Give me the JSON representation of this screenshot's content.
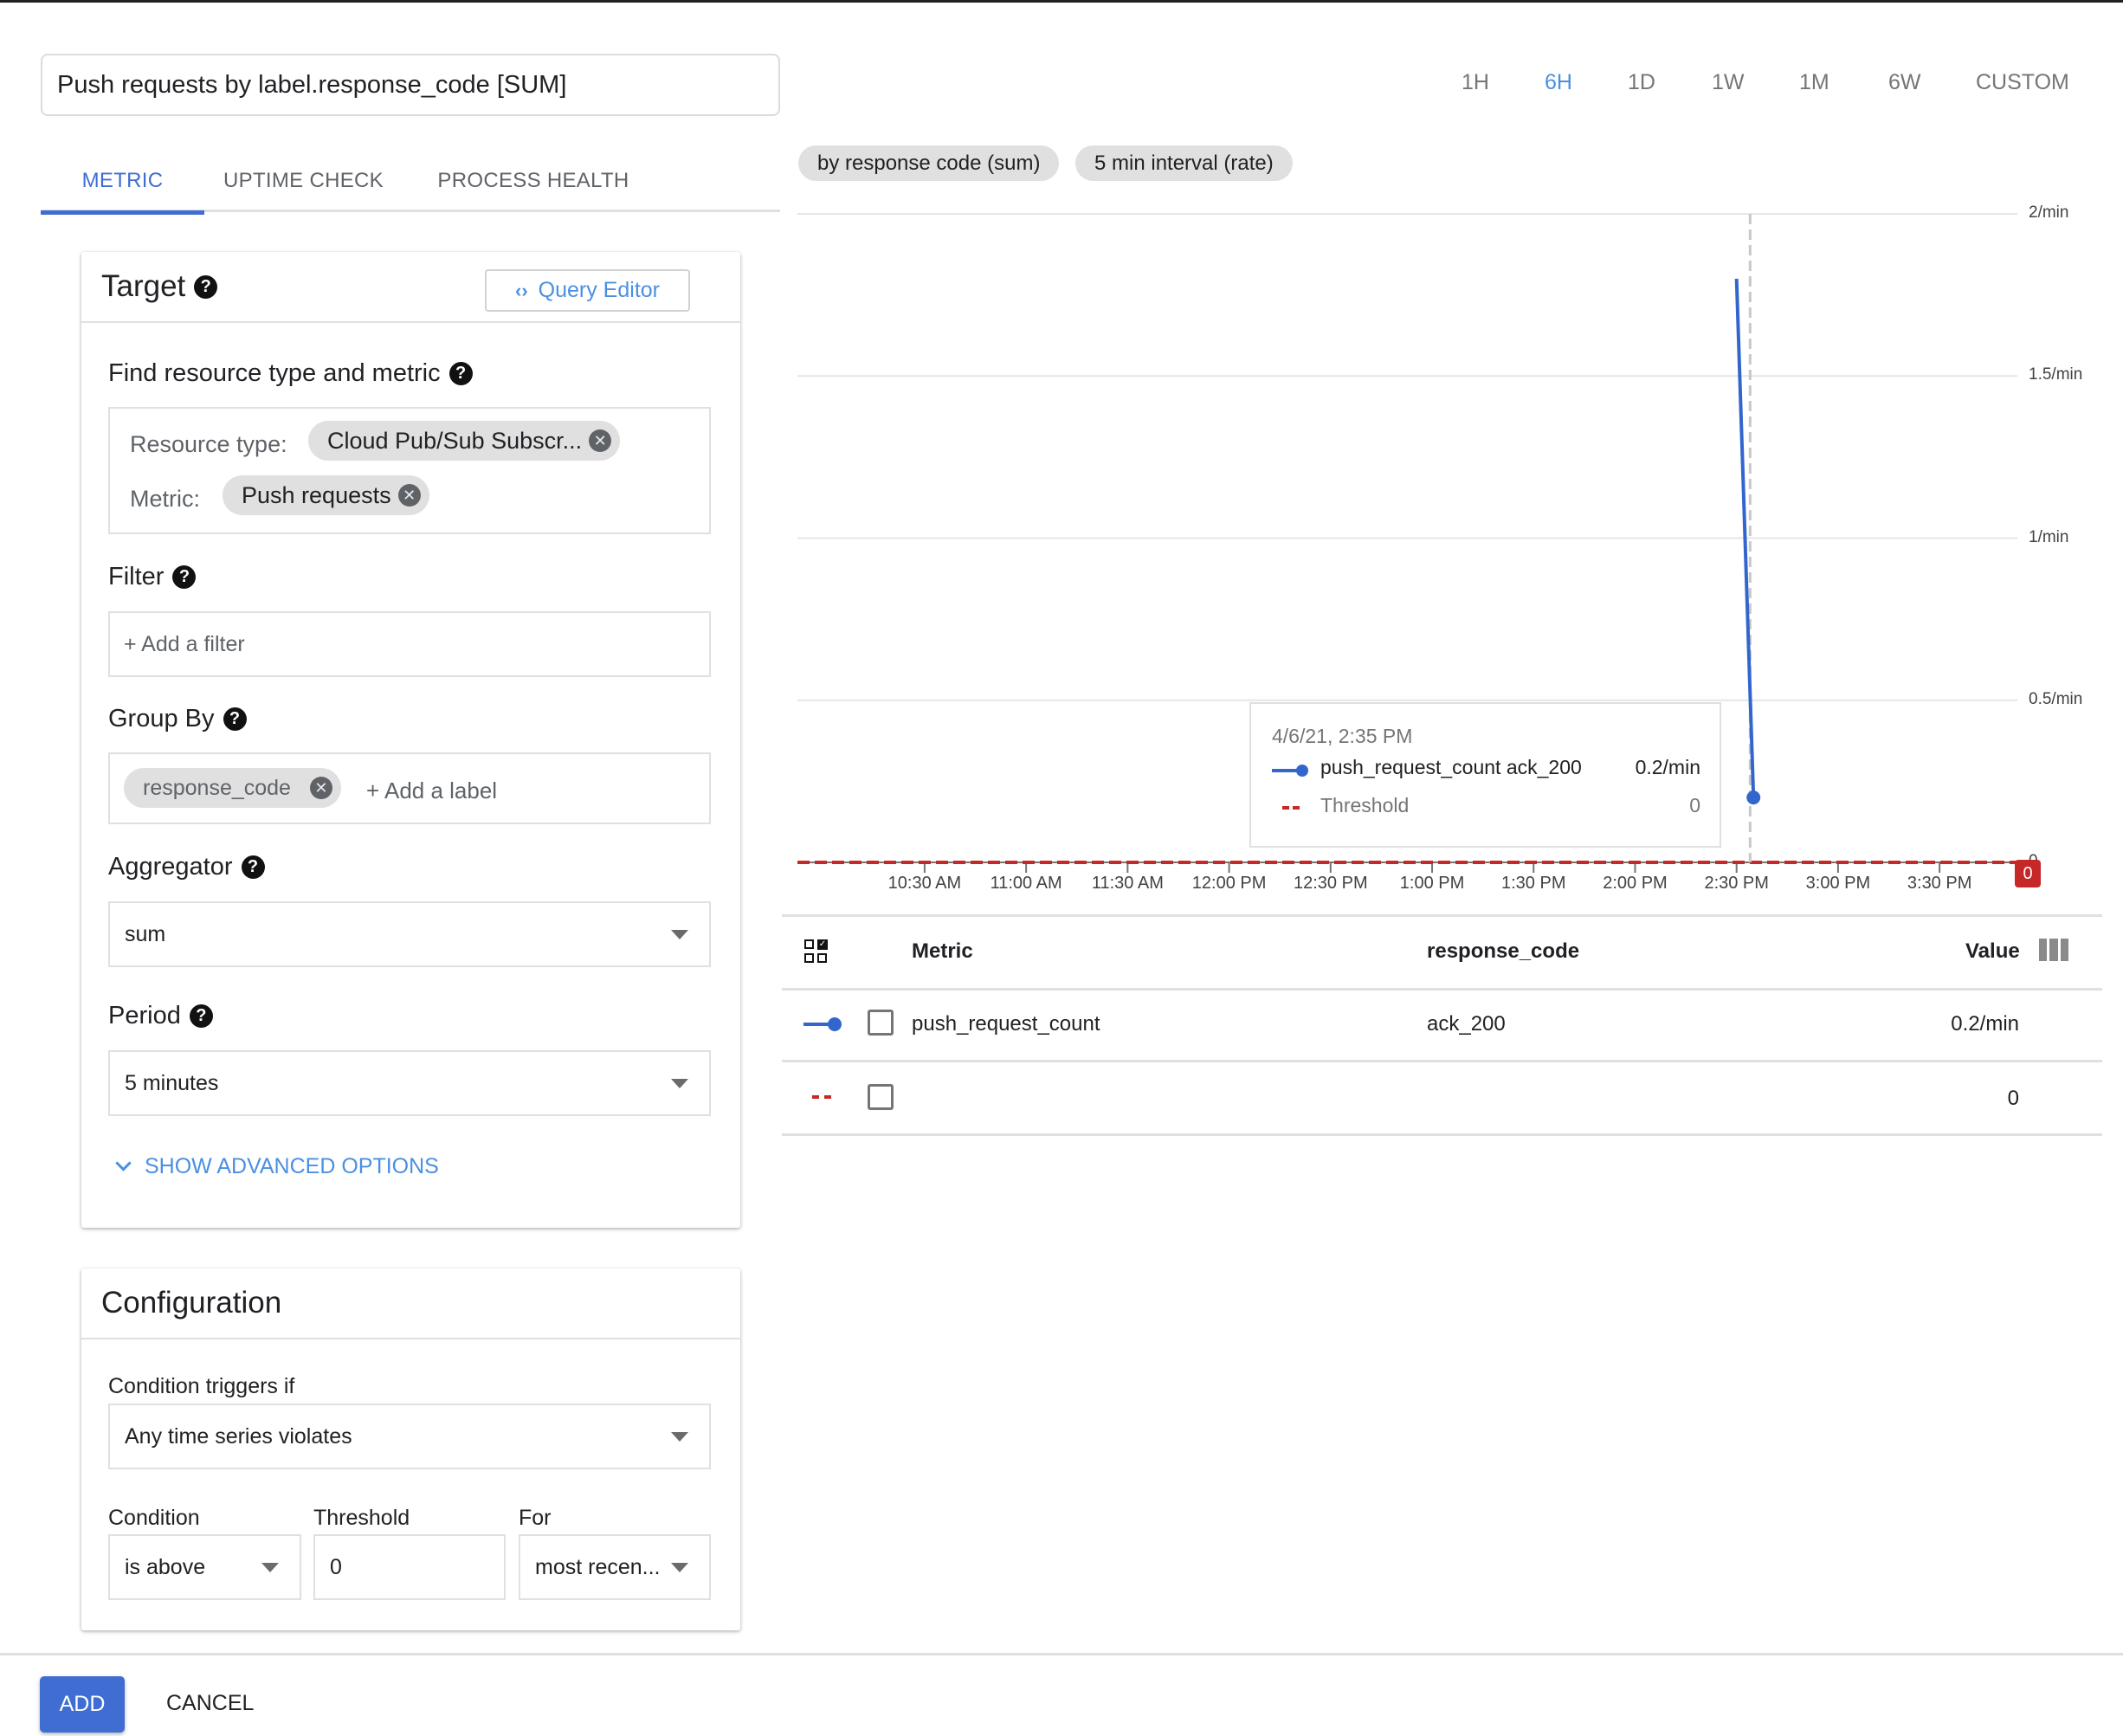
{
  "title_input": {
    "value": "Push requests by label.response_code [SUM]"
  },
  "tabs": [
    {
      "label": "METRIC",
      "active": true
    },
    {
      "label": "UPTIME CHECK",
      "active": false
    },
    {
      "label": "PROCESS HEALTH",
      "active": false
    }
  ],
  "time_ranges": [
    {
      "label": "1H",
      "active": false
    },
    {
      "label": "6H",
      "active": true
    },
    {
      "label": "1D",
      "active": false
    },
    {
      "label": "1W",
      "active": false
    },
    {
      "label": "1M",
      "active": false
    },
    {
      "label": "6W",
      "active": false
    },
    {
      "label": "CUSTOM",
      "active": false
    }
  ],
  "chart_pills": [
    "by response code (sum)",
    "5 min interval (rate)"
  ],
  "target": {
    "title": "Target",
    "help_icon": "help-icon",
    "query_editor": {
      "icon": "code-icon",
      "label": "Query Editor"
    },
    "find_label": "Find resource type and metric",
    "resource_type_label": "Resource type:",
    "resource_type_value": "Cloud Pub/Sub Subscr...",
    "metric_label": "Metric:",
    "metric_value": "Push requests",
    "filter_label": "Filter",
    "filter_placeholder": "+ Add a filter",
    "group_by_label": "Group By",
    "group_by_chip": "response_code",
    "group_by_add": "+ Add a label",
    "aggregator_label": "Aggregator",
    "aggregator_value": "sum",
    "period_label": "Period",
    "period_value": "5 minutes",
    "advanced_label": "SHOW ADVANCED OPTIONS"
  },
  "configuration": {
    "title": "Configuration",
    "triggers_label": "Condition triggers if",
    "triggers_value": "Any time series violates",
    "condition_label": "Condition",
    "condition_value": "is above",
    "threshold_label": "Threshold",
    "threshold_value": "0",
    "for_label": "For",
    "for_value": "most recen..."
  },
  "footer": {
    "add_label": "ADD",
    "cancel_label": "CANCEL"
  },
  "colors": {
    "accent": "#3f6dd1",
    "link": "#4a90e2",
    "series": "#3366cc",
    "threshold": "#c62828"
  },
  "tooltip": {
    "timestamp": "4/6/21, 2:35 PM",
    "rows": [
      {
        "name": "push_request_count ack_200",
        "value": "0.2/min"
      },
      {
        "name": "Threshold",
        "value": "0"
      }
    ]
  },
  "threshold_badge": "0",
  "table": {
    "headers": {
      "metric": "Metric",
      "response_code": "response_code",
      "value": "Value"
    },
    "rows": [
      {
        "metric": "push_request_count",
        "response_code": "ack_200",
        "value": "0.2/min",
        "legend": "series"
      },
      {
        "metric": "",
        "response_code": "",
        "value": "0",
        "legend": "threshold"
      }
    ]
  },
  "chart_data": {
    "type": "line",
    "title": "",
    "xlabel": "",
    "ylabel": "",
    "x_ticks": [
      "10:30 AM",
      "11:00 AM",
      "11:30 AM",
      "12:00 PM",
      "12:30 PM",
      "1:00 PM",
      "1:30 PM",
      "2:00 PM",
      "2:30 PM",
      "3:00 PM",
      "3:30 PM"
    ],
    "y_ticks": [
      "0",
      "0.5/min",
      "1/min",
      "1.5/min",
      "2/min"
    ],
    "y_tick_values": [
      0,
      0.5,
      1,
      1.5,
      2
    ],
    "ylim": [
      0,
      2
    ],
    "xlim_minutes_from_1030": [
      -37.6,
      323
    ],
    "grid": true,
    "series": [
      {
        "name": "push_request_count ack_200",
        "x_minutes_from_1030": [
          240,
          245
        ],
        "x": [
          "2:30 PM",
          "2:35 PM"
        ],
        "values": [
          1.8,
          0.2
        ]
      }
    ],
    "threshold": {
      "name": "Threshold",
      "value": 0
    },
    "cursor_minutes_from_1030": [
      244
    ]
  }
}
